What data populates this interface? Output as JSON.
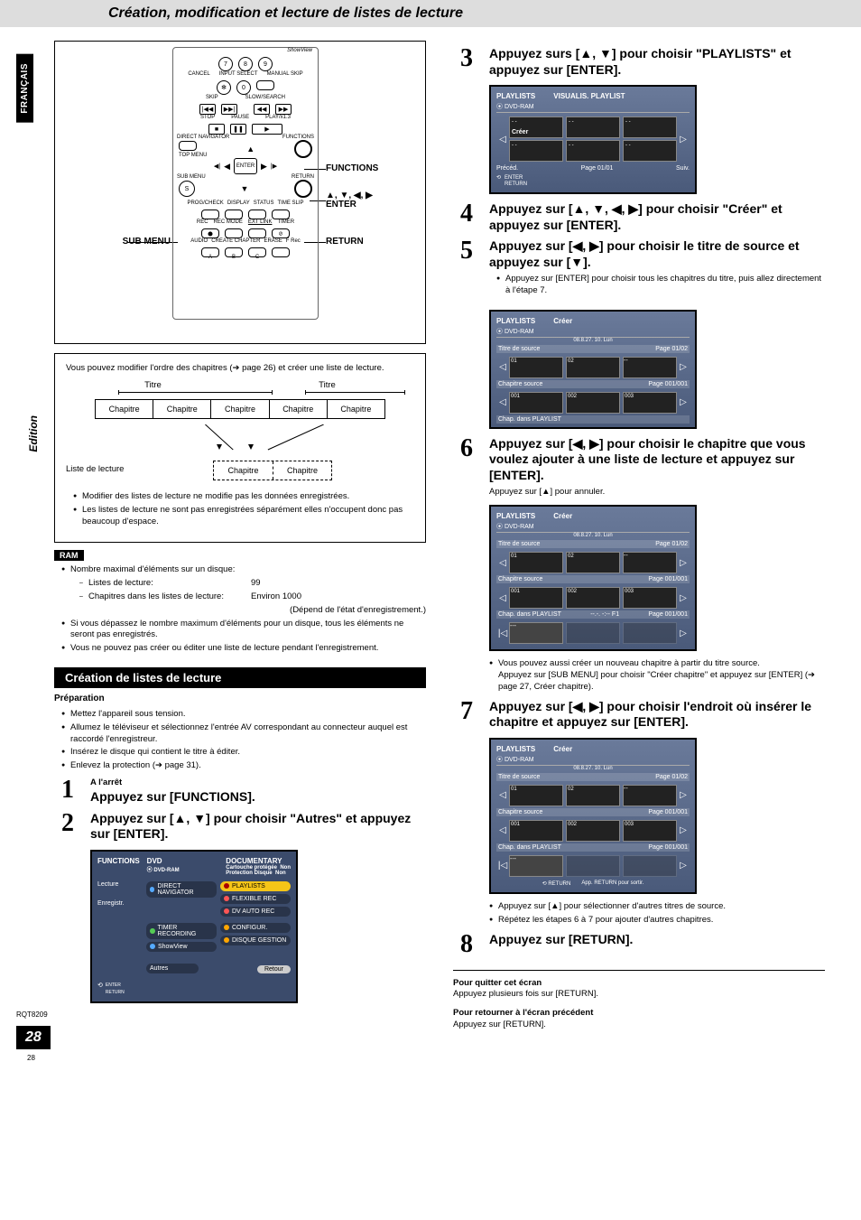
{
  "page": {
    "title": "Création, modification et lecture de listes de lecture",
    "side_tab": "FRANÇAIS",
    "side_label": "Edition",
    "rqt": "RQT8209",
    "page_num": "28",
    "tiny_pg": "28"
  },
  "remote": {
    "labels_right": {
      "functions": "FUNCTIONS",
      "arrows": "▲, ▼, ◀, ▶",
      "enter": "ENTER",
      "return": "RETURN"
    },
    "labels_left": {
      "sub_menu": "SUB MENU"
    },
    "btn_rows": {
      "nums": [
        "7",
        "8",
        "9"
      ],
      "cancel": "CANCEL",
      "input_select": "INPUT SELECT",
      "manual_skip": "MANUAL SKIP",
      "star": "✻",
      "zero": "0",
      "skip": "SKIP",
      "slow": "SLOW/SEARCH",
      "stop": "STOP",
      "pause": "PAUSE",
      "play": "PLAY/x1.3",
      "direct_nav": "DIRECT NAVIGATOR",
      "functions": "FUNCTIONS",
      "top_menu": "TOP MENU",
      "enter": "ENTER",
      "sub_menu": "SUB MENU",
      "return": "RETURN",
      "s_btn": "S",
      "progcheck": "PROG/CHECK",
      "display": "DISPLAY",
      "status": "STATUS",
      "time_slip": "TIME SLIP",
      "rec": "REC",
      "rec_mode": "REC MODE",
      "ext_link": "EXT LINK",
      "timer": "TIMER",
      "audio": "AUDIO",
      "create_chapter": "CREATE CHAPTER",
      "erase": "ERASE",
      "frec": "F Rec",
      "abc": [
        "A",
        "B",
        "C"
      ],
      "showview": "ShowView"
    }
  },
  "diagram": {
    "intro": "Vous pouvez modifier l'ordre des chapitres (➔ page 26) et créer une liste de lecture.",
    "titre": "Titre",
    "chapitre": "Chapitre",
    "liste_label": "Liste de lecture",
    "bullets": [
      "Modifier des listes de lecture ne modifie pas les données enregistrées.",
      "Les listes de lecture ne sont pas enregistrées séparément elles n'occupent donc pas beaucoup d'espace."
    ]
  },
  "ram": {
    "tag": "RAM",
    "max_label": "Nombre maximal d'éléments sur un disque:",
    "items": [
      {
        "name": "Listes de lecture:",
        "val": "99"
      },
      {
        "name": "Chapitres dans les listes de lecture:",
        "val": "Environ 1000"
      }
    ],
    "paren": "(Dépend de l'état d'enregistrement.)",
    "bullets": [
      "Si vous dépassez le nombre maximum d'éléments pour un disque, tous les éléments ne seront pas enregistrés.",
      "Vous ne pouvez pas créer ou éditer une liste de lecture pendant l'enregistrement."
    ]
  },
  "section_header": "Création de listes de lecture",
  "prep": {
    "label": "Préparation",
    "items": [
      "Mettez l'appareil sous tension.",
      "Allumez le téléviseur et sélectionnez l'entrée AV correspondant au connecteur auquel est raccordé l'enregistreur.",
      "Insérez le disque qui contient le titre à éditer.",
      "Enlevez la protection (➔ page 31)."
    ]
  },
  "steps": {
    "s1": {
      "n": "1",
      "lead": "A l'arrêt",
      "title": "Appuyez sur [FUNCTIONS]."
    },
    "s2": {
      "n": "2",
      "title": "Appuyez sur [▲, ▼] pour choisir \"Autres\" et appuyez sur [ENTER]."
    },
    "s3": {
      "n": "3",
      "title": "Appuyez surs [▲, ▼] pour choisir \"PLAYLISTS\" et appuyez sur [ENTER]."
    },
    "s4": {
      "n": "4",
      "title": "Appuyez sur [▲, ▼, ◀, ▶] pour choisir \"Créer\" et appuyez sur [ENTER]."
    },
    "s5": {
      "n": "5",
      "title": "Appuyez sur [◀, ▶] pour choisir le titre de source et appuyez sur [▼].",
      "sub": "Appuyez sur [ENTER] pour choisir tous les chapitres du titre, puis allez directement à l'étape 7."
    },
    "s6": {
      "n": "6",
      "title": "Appuyez sur [◀, ▶] pour choisir le chapitre que vous voulez ajouter à une liste de lecture et appuyez sur [ENTER].",
      "sub": "Appuyez sur [▲] pour annuler.",
      "notes": [
        "Vous pouvez aussi créer un nouveau chapitre à partir du titre source.",
        "Appuyez sur [SUB MENU] pour choisir \"Créer chapitre\" et appuyez sur [ENTER] (➔ page 27, Créer chapitre)."
      ]
    },
    "s7": {
      "n": "7",
      "title": "Appuyez sur [◀, ▶] pour choisir l'endroit où insérer le chapitre et appuyez sur [ENTER].",
      "notes": [
        "Appuyez sur [▲] pour sélectionner d'autres titres de source.",
        "Répétez les étapes 6 à 7 pour ajouter d'autres chapitres."
      ]
    },
    "s8": {
      "n": "8",
      "title": "Appuyez sur [RETURN]."
    }
  },
  "screens": {
    "playlists": {
      "hdr": "PLAYLISTS",
      "hdr2": "VISUALIS. PLAYLIST",
      "disc": "DVD-RAM",
      "creer": "Créer",
      "preced": "Précéd.",
      "page": "Page 01/01",
      "suiv": "Suiv.",
      "enter": "ENTER",
      "return": "RETURN"
    },
    "creer1": {
      "hdr": "PLAYLISTS",
      "mode": "Créer",
      "disc": "DVD-RAM",
      "date": "08.8.27. 10. Lun",
      "titre_src": "Titre de source",
      "chap_src": "Chapitre source",
      "chap_pl": "Chap. dans PLAYLIST",
      "pg1": "Page 01/02",
      "pg2": "Page 001/001",
      "n01": "01",
      "n02": "02",
      "n001": "001",
      "n002": "002",
      "n003": "003"
    },
    "creer2": {
      "hdr": "PLAYLISTS",
      "mode": "Créer",
      "disc": "DVD-RAM",
      "date": "08.8.27. 10. Lun",
      "titre_src": "Titre de source",
      "chap_src": "Chapitre source",
      "chap_pl": "Chap. dans PLAYLIST",
      "time": "--.-. -:-- F1",
      "pg1": "Page 01/02",
      "pg2": "Page 001/001",
      "pg3": "Page 001/001"
    },
    "creer3": {
      "hdr": "PLAYLISTS",
      "mode": "Créer",
      "disc": "DVD-RAM",
      "date": "08.8.27. 10. Lun",
      "titre_src": "Titre de source",
      "chap_src": "Chapitre source",
      "chap_pl": "Chap. dans PLAYLIST",
      "pg1": "Page 01/02",
      "pg2": "Page 001/001",
      "pg3": "Page 001/001",
      "return": "RETURN",
      "return_msg": "App. RETURN pour sortir."
    },
    "functions": {
      "hdr": "FUNCTIONS",
      "dvd": "DVD",
      "disc": "DVD-RAM",
      "doc": "DOCUMENTARY",
      "cart": "Cartouche protégée",
      "prot": "Protection Disque",
      "non": "Non",
      "lecture": "Lecture",
      "enreg": "Enregistr.",
      "autres": "Autres",
      "direct_nav": "DIRECT NAVIGATOR",
      "playlists": "PLAYLISTS",
      "flex": "FLEXIBLE REC",
      "dvauto": "DV AUTO REC",
      "timer": "TIMER RECORDING",
      "showview": "ShowView",
      "config": "CONFIGUR.",
      "disque_g": "DISQUE GESTION",
      "retour": "Retour",
      "enter": "ENTER",
      "return": "RETURN"
    }
  },
  "endbox": {
    "quit_t": "Pour quitter cet écran",
    "quit_b": "Appuyez plusieurs fois sur [RETURN].",
    "prev_t": "Pour retourner à l'écran précédent",
    "prev_b": "Appuyez sur [RETURN]."
  }
}
